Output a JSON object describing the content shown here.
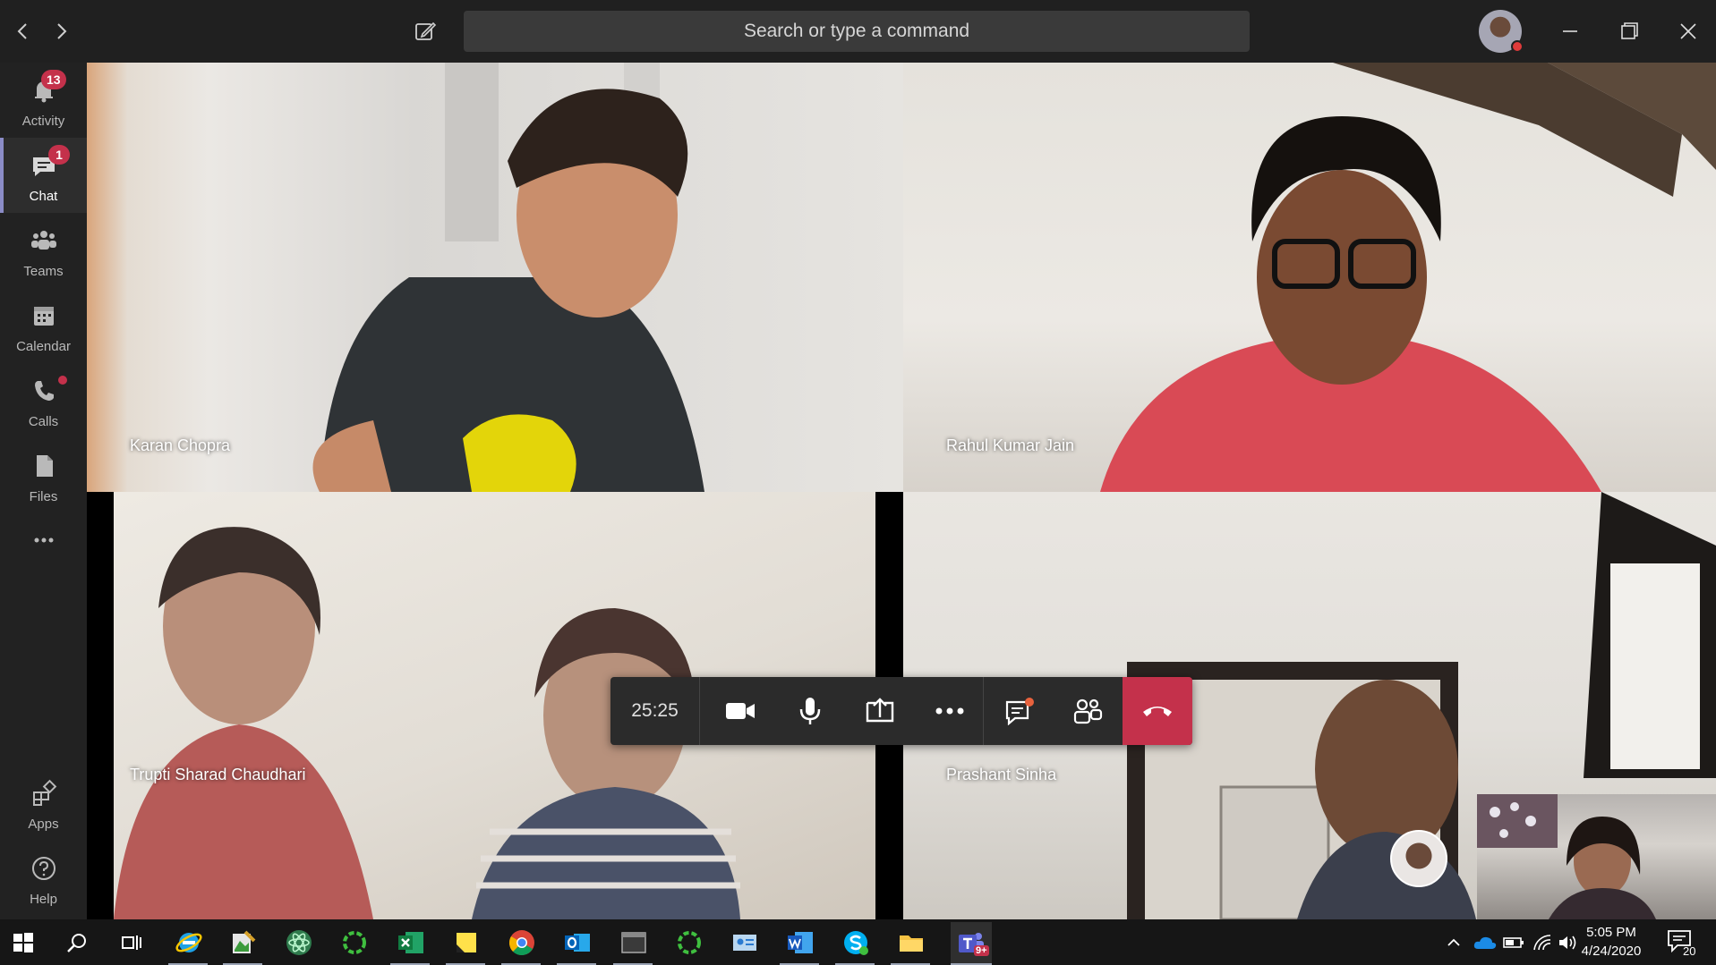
{
  "titlebar": {
    "search_placeholder": "Search or type a command",
    "back_icon": "chevron-left-icon",
    "forward_icon": "chevron-right-icon",
    "compose_icon": "compose-icon"
  },
  "rail": {
    "items": [
      {
        "label": "Activity",
        "icon": "bell-icon",
        "badge": "13",
        "active": false
      },
      {
        "label": "Chat",
        "icon": "chat-icon",
        "badge": "1",
        "active": true
      },
      {
        "label": "Teams",
        "icon": "teams-icon",
        "badge": "",
        "active": false
      },
      {
        "label": "Calendar",
        "icon": "calendar-icon",
        "badge": "",
        "active": false
      },
      {
        "label": "Calls",
        "icon": "phone-icon",
        "badge": "",
        "active": false,
        "dot": true
      },
      {
        "label": "Files",
        "icon": "file-icon",
        "badge": "",
        "active": false
      }
    ],
    "more_icon": "ellipsis-icon",
    "bottom_items": [
      {
        "label": "Apps",
        "icon": "apps-icon"
      },
      {
        "label": "Help",
        "icon": "help-icon"
      }
    ]
  },
  "participants": [
    {
      "name": "Karan Chopra"
    },
    {
      "name": "Rahul Kumar Jain"
    },
    {
      "name": "Trupti Sharad Chaudhari"
    },
    {
      "name": "Prashant Sinha"
    }
  ],
  "call_controls": {
    "timer": "25:25",
    "buttons": [
      "camera-icon",
      "microphone-icon",
      "share-screen-icon",
      "more-actions-icon",
      "chat-icon",
      "participants-icon",
      "hang-up-icon"
    ]
  },
  "taskbar": {
    "time": "5:05 PM",
    "date": "4/24/2020",
    "notification_count": "20",
    "teams_badge": "9+"
  },
  "colors": {
    "accent": "#8b8cc7",
    "badge": "#c4314b",
    "hangup": "#c4314b",
    "taskbar": "#161616"
  }
}
